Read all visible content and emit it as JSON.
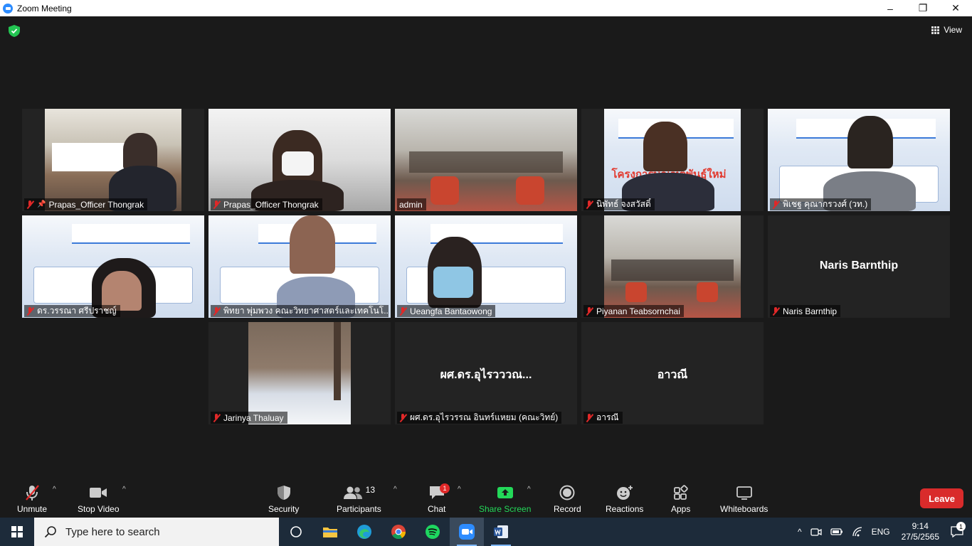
{
  "window": {
    "title": "Zoom Meeting",
    "minimize": "–",
    "maximize": "❐",
    "close": "✕"
  },
  "meeting": {
    "view_label": "View",
    "tiles": [
      {
        "name": "Prapas_Officer Thongrak",
        "muted": true,
        "pinned": true,
        "bg": "room"
      },
      {
        "name": "Prapas_Officer Thongrak",
        "muted": true,
        "bg": "office"
      },
      {
        "name": "admin",
        "muted": false,
        "active": true,
        "bg": "hall"
      },
      {
        "name": "นิพัทธ์ จงสวัสดิ์",
        "muted": true,
        "bg": "poster"
      },
      {
        "name": "พิเชฐ  คุณากรวงศ์ (วท.)",
        "muted": true,
        "bg": "poster"
      },
      {
        "name": "ดร.วรรณา ศรีปราชญ์",
        "muted": true,
        "bg": "poster"
      },
      {
        "name": "พิทยา  พุ่มพวง คณะวิทยาศาสตร์และเทคโนโ...",
        "muted": true,
        "bg": "poster"
      },
      {
        "name": "Ueangfa Bantaowong",
        "muted": true,
        "bg": "poster"
      },
      {
        "name": "Piyanan Teabsornchai",
        "muted": true,
        "bg": "hall"
      },
      {
        "name": "Naris Barnthip",
        "muted": true,
        "display": "Naris Barnthip"
      },
      {
        "name": "Jarinya Thaluay",
        "muted": true,
        "bg": "snow"
      },
      {
        "name": "ผศ.ดร.อุไรวรรณ อินทร์แหยม (คณะวิทย์)",
        "muted": true,
        "display": "ผศ.ดร.อุไรวววณ..."
      },
      {
        "name": "อารณี",
        "muted": true,
        "display": "อาวณี"
      }
    ],
    "poster": {
      "title": "โครงการบัณฑิตพันธุ์ใหม่"
    }
  },
  "toolbar": {
    "unmute": "Unmute",
    "stop_video": "Stop Video",
    "security": "Security",
    "participants": "Participants",
    "participants_count": "13",
    "chat": "Chat",
    "chat_badge": "1",
    "share_screen": "Share Screen",
    "record": "Record",
    "reactions": "Reactions",
    "apps": "Apps",
    "whiteboards": "Whiteboards",
    "leave": "Leave"
  },
  "taskbar": {
    "search_placeholder": "Type here to search",
    "language": "ENG",
    "time": "9:14",
    "date": "27/5/2565",
    "notifications": "1"
  }
}
